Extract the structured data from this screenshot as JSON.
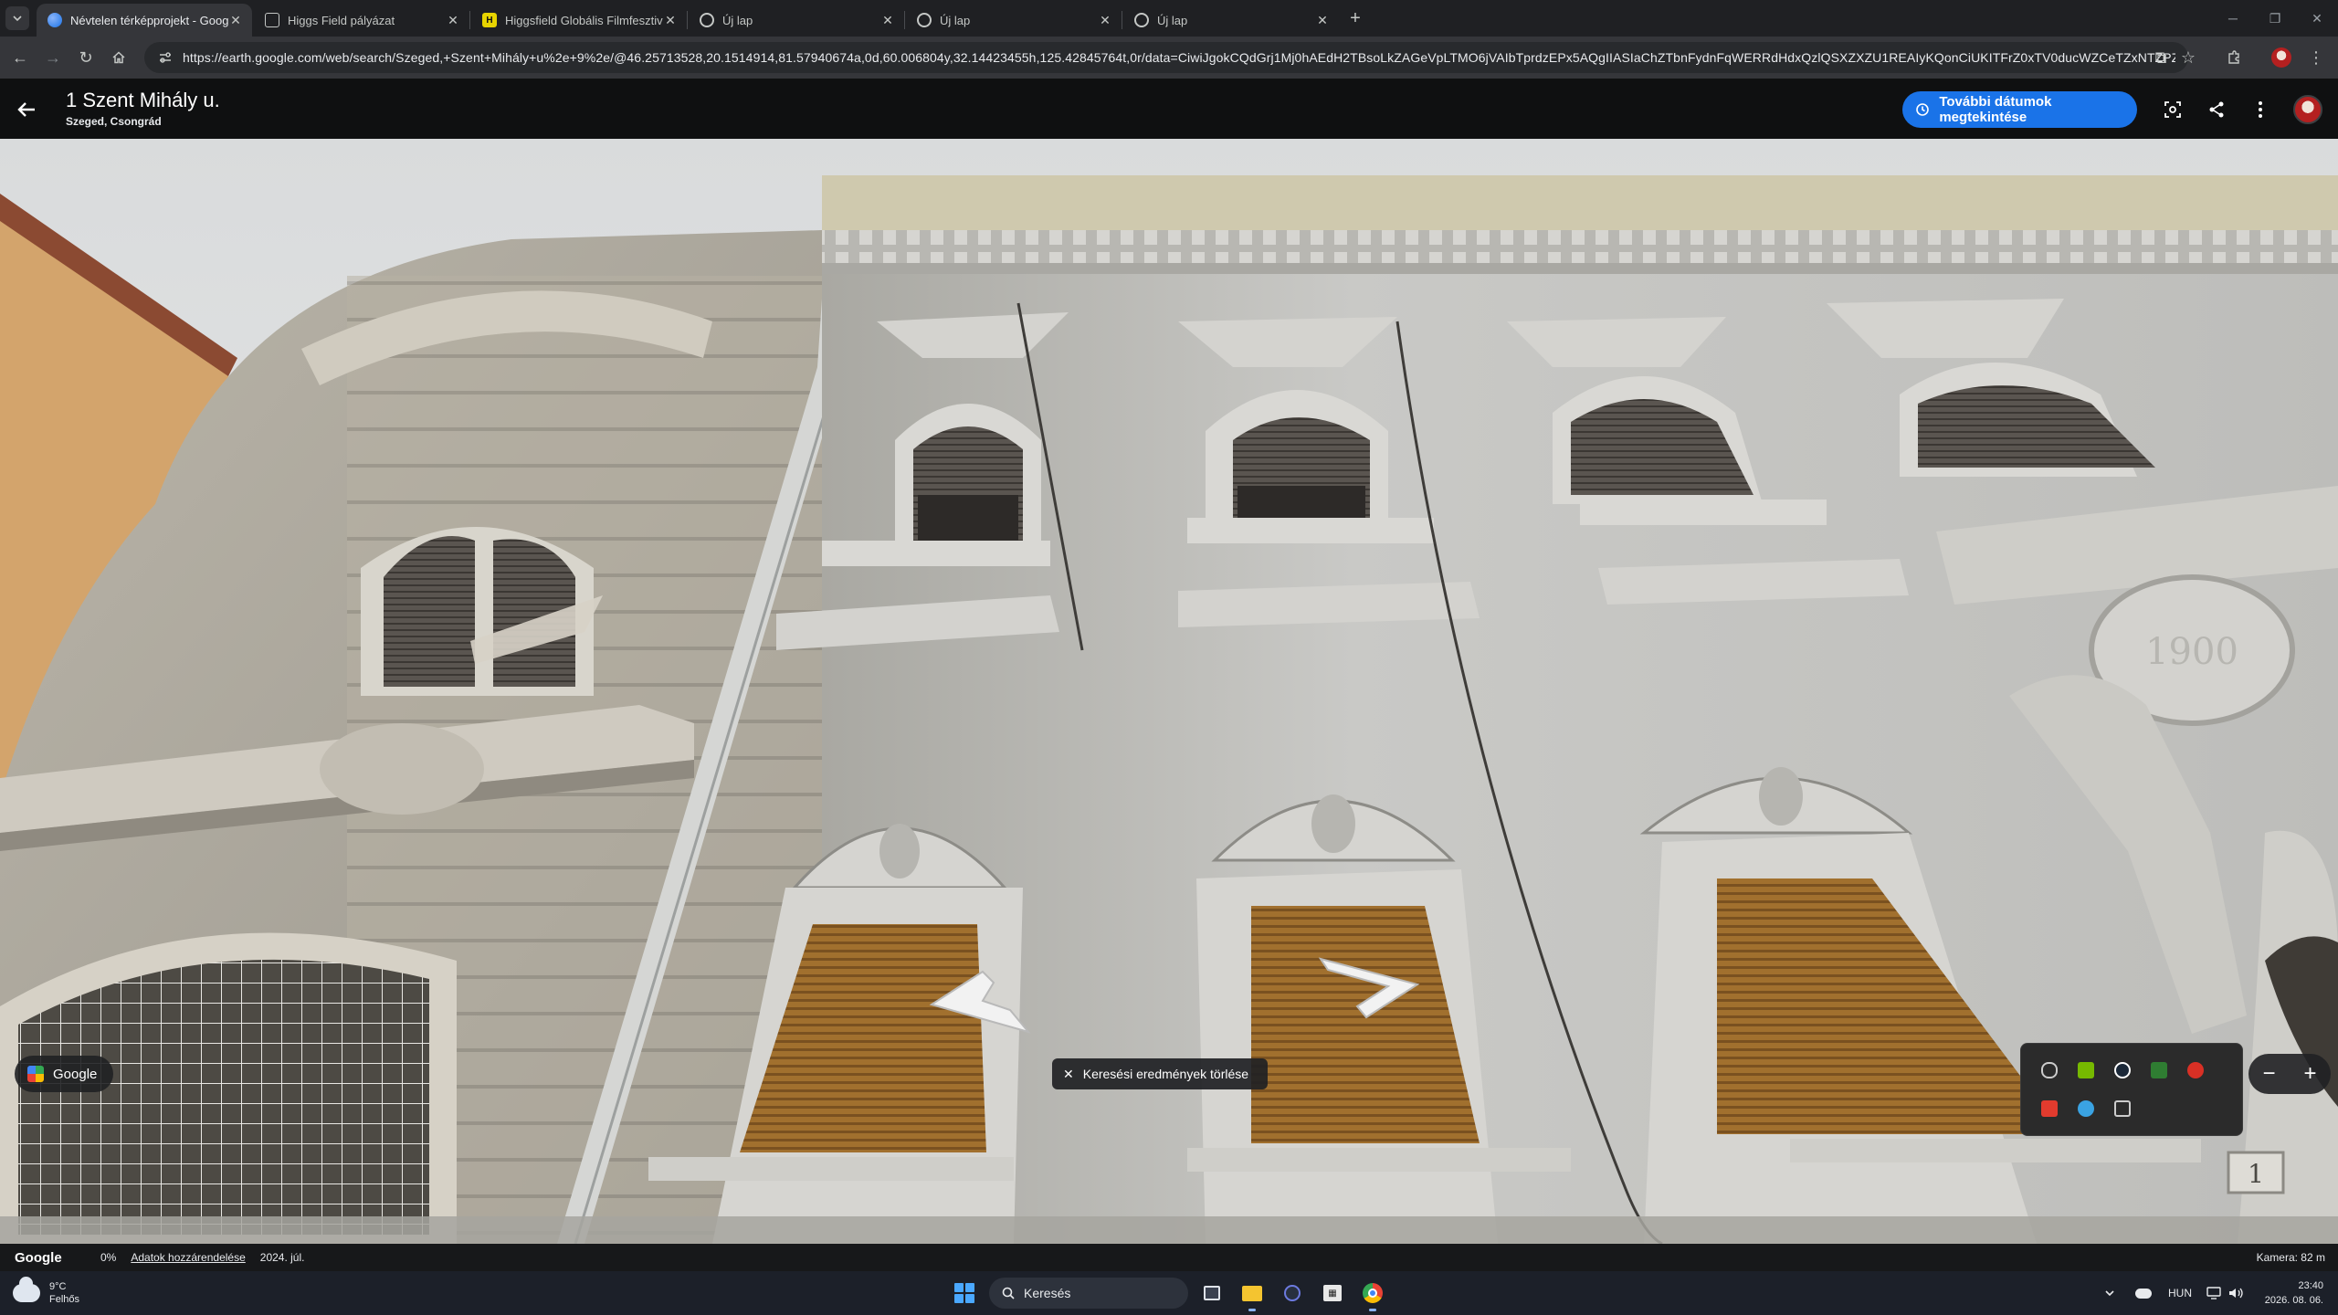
{
  "browser": {
    "tabs": [
      {
        "title": "Névtelen térképprojekt - Google",
        "favicon": "google-earth-icon",
        "active": true
      },
      {
        "title": "Higgs Field pályázat",
        "favicon": "document-icon",
        "active": false
      },
      {
        "title": "Higgsfield Globális Filmfesztivál",
        "favicon": "higgsfield-icon",
        "active": false
      },
      {
        "title": "Új lap",
        "favicon": "chrome-icon",
        "active": false
      },
      {
        "title": "Új lap",
        "favicon": "chrome-icon",
        "active": false
      },
      {
        "title": "Új lap",
        "favicon": "chrome-icon",
        "active": false
      }
    ],
    "url": "https://earth.google.com/web/search/Szeged,+Szent+Mihály+u%2e+9%2e/@46.25713528,20.1514914,81.57940674a,0d,60.006804y,32.14423455h,125.42845764t,0r/data=CiwiJgokCQdGrj1Mj0hAEdH2TBsoLkZAGeVpLTMO6jVAIbTprdzEPx5AQgIIASIaChZTbnFydnFqWERRdHdxQzlQSXZXZU1REAIyKQonCiUKITFrZ0xTV0ducWZCeTZxNTZPZ3dXU0Q1c..."
  },
  "maps": {
    "place_title": "1 Szent Mihály u.",
    "place_subtitle": "Szeged, Csongrád",
    "dates_button": "További dátumok megtekintése",
    "google_chip": "Google",
    "clear_search": "Keresési eredmények törlése",
    "zoom_minus": "−",
    "zoom_plus": "+",
    "building_year": "1900",
    "house_number": "1"
  },
  "footer": {
    "logo": "Google",
    "percent": "0%",
    "data_attribution": "Adatok hozzárendelése",
    "capture_date": "2024. júl.",
    "camera": "Kamera: 82 m"
  },
  "taskbar": {
    "temperature": "9°C",
    "weather": "Felhős",
    "search_placeholder": "Keresés",
    "language": "HUN",
    "time": "23:40",
    "date": "2026. 08. 06."
  },
  "colors": {
    "accent": "#1a73e8",
    "header_bg": "#0f1011",
    "tab_active": "#35363a"
  }
}
